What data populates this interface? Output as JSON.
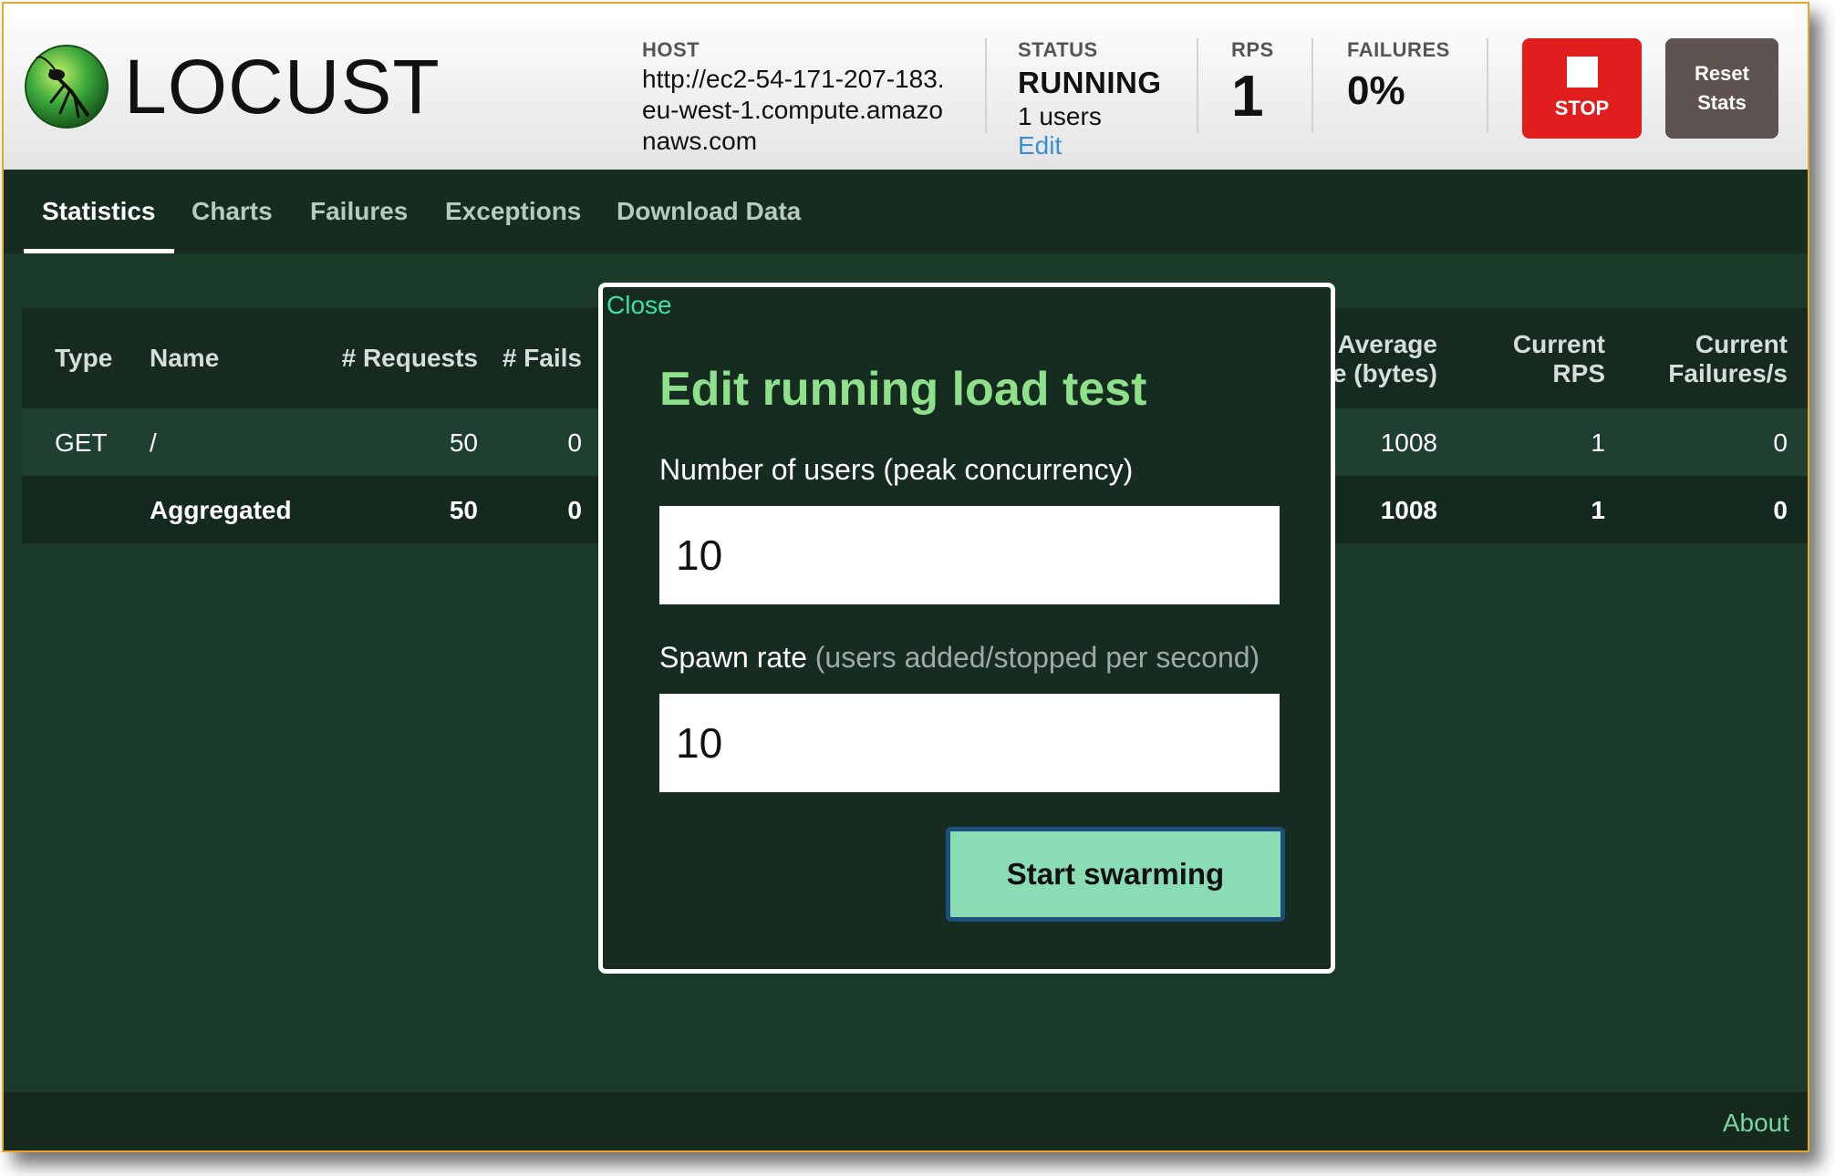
{
  "brand": {
    "name": "LOCUST"
  },
  "header": {
    "host_label": "HOST",
    "host_value": "http://ec2-54-171-207-183.eu-west-1.compute.amazonaws.com",
    "status_label": "STATUS",
    "status_value": "RUNNING",
    "users": "1 users",
    "edit_link": "Edit",
    "rps_label": "RPS",
    "rps_value": "1",
    "failures_label": "FAILURES",
    "failures_value": "0%",
    "stop_label": "STOP",
    "reset_label": "Reset Stats"
  },
  "tabs": [
    {
      "label": "Statistics",
      "active": true
    },
    {
      "label": "Charts"
    },
    {
      "label": "Failures"
    },
    {
      "label": "Exceptions"
    },
    {
      "label": "Download Data"
    }
  ],
  "table": {
    "headers": {
      "type": "Type",
      "name": "Name",
      "requests": "# Requests",
      "fails": "# Fails",
      "avg_size": "Average\nsize (bytes)",
      "current_rps": "Current\nRPS",
      "current_failures": "Current\nFailures/s"
    },
    "rows": [
      {
        "type": "GET",
        "name": "/",
        "requests": "50",
        "fails": "0",
        "avg_size": "1008",
        "current_rps": "1",
        "current_failures": "0"
      },
      {
        "type": "",
        "name": "Aggregated",
        "requests": "50",
        "fails": "0",
        "avg_size": "1008",
        "current_rps": "1",
        "current_failures": "0"
      }
    ]
  },
  "modal": {
    "close_label": "Close",
    "title": "Edit running load test",
    "users_label": "Number of users (peak concurrency)",
    "users_value": "10",
    "spawn_label": "Spawn rate",
    "spawn_hint": "(users added/stopped per second)",
    "spawn_value": "10",
    "submit_label": "Start swarming"
  },
  "footer": {
    "about_label": "About"
  },
  "colors": {
    "stop": "#e01e1e",
    "reset": "#5e5350",
    "accent_green": "#8ee08a",
    "button_green": "#8adcb4",
    "link_blue": "#3b8fd1"
  }
}
